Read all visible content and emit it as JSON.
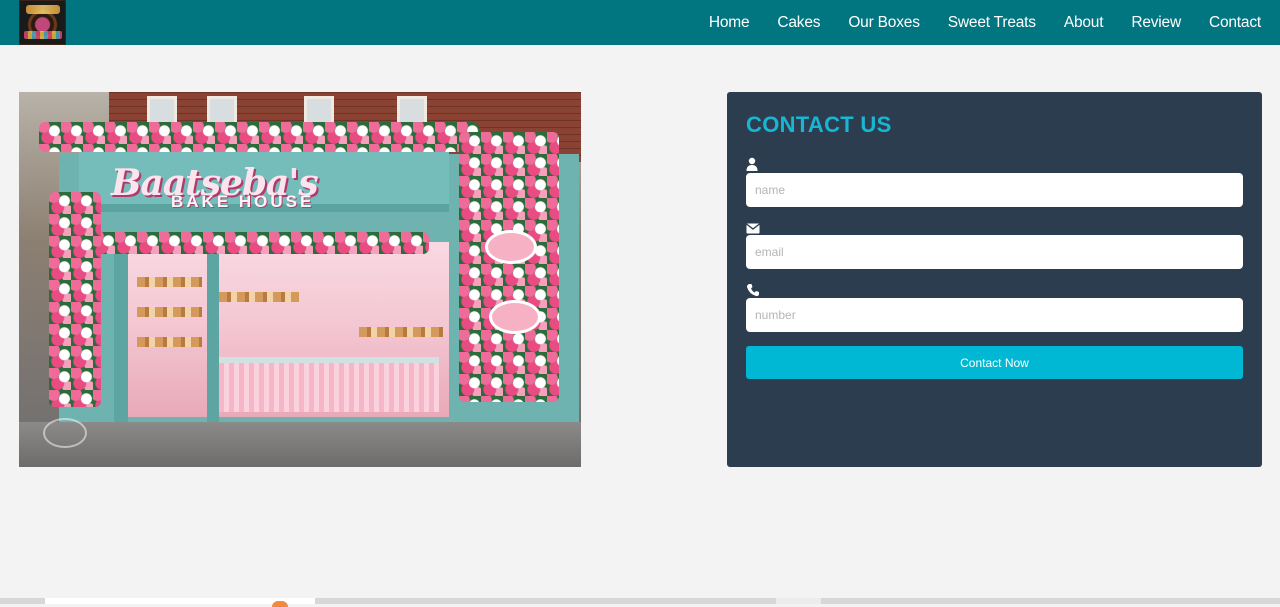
{
  "nav": {
    "logo_icon": "bakery-logo-icon",
    "links": [
      "Home",
      "Cakes",
      "Our Boxes",
      "Sweet Treats",
      "About",
      "Review",
      "Contact"
    ]
  },
  "hero_image": {
    "sign_text": "Baatseba's",
    "sign_subtext": "BAKE HOUSE"
  },
  "contact": {
    "title": "CONTACT US",
    "fields": [
      {
        "icon": "user-icon",
        "placeholder": "name"
      },
      {
        "icon": "envelope-icon",
        "placeholder": "email"
      },
      {
        "icon": "phone-icon",
        "placeholder": "number"
      }
    ],
    "submit_label": "Contact Now"
  },
  "colors": {
    "navbar": "#017580",
    "card": "#2d3d50",
    "accent": "#17b6d3",
    "button": "#00b8d4",
    "page_bg": "#f3f3f3"
  }
}
